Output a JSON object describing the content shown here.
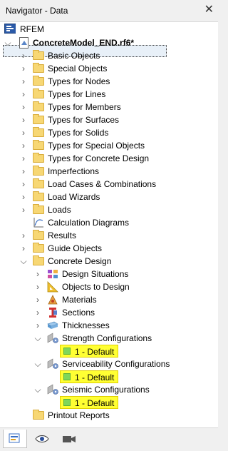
{
  "window": {
    "title": "Navigator - Data",
    "close_glyph": "✕"
  },
  "tree": {
    "root": "RFEM",
    "model": "ConcreteModel_END.rf6*",
    "items": [
      "Basic Objects",
      "Special Objects",
      "Types for Nodes",
      "Types for Lines",
      "Types for Members",
      "Types for Surfaces",
      "Types for Solids",
      "Types for Special Objects",
      "Types for Concrete Design",
      "Imperfections",
      "Load Cases & Combinations",
      "Load Wizards",
      "Loads",
      "Calculation Diagrams",
      "Results",
      "Guide Objects",
      "Concrete Design"
    ],
    "concrete_design": {
      "children": [
        "Design Situations",
        "Objects to Design",
        "Materials",
        "Sections",
        "Thicknesses",
        "Strength Configurations",
        "Serviceability Configurations",
        "Seismic Configurations"
      ],
      "default_label": "1 - Default"
    },
    "printout": "Printout Reports"
  },
  "tabs": [
    "data-tab-icon",
    "view-tab-icon",
    "camera-tab-icon"
  ],
  "colors": {
    "highlight": "#ffff33",
    "folder": "#f7d774"
  }
}
